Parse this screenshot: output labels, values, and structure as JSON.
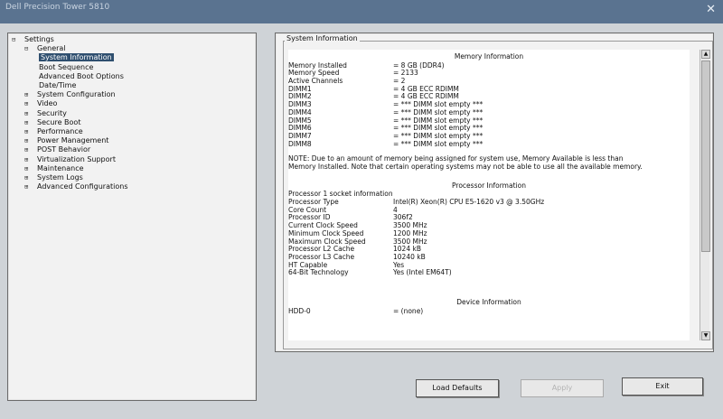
{
  "window": {
    "title": "Dell Precision Tower 5810",
    "close_icon": "close-icon"
  },
  "left_tree": {
    "root": "Settings",
    "items": [
      {
        "label": "General",
        "expanded": true,
        "children": [
          {
            "label": "System Information",
            "selected": true
          },
          {
            "label": "Boot Sequence"
          },
          {
            "label": "Advanced Boot Options"
          },
          {
            "label": "Date/Time"
          }
        ]
      },
      {
        "label": "System Configuration"
      },
      {
        "label": "Video"
      },
      {
        "label": "Security"
      },
      {
        "label": "Secure Boot"
      },
      {
        "label": "Performance"
      },
      {
        "label": "Power Management"
      },
      {
        "label": "POST Behavior"
      },
      {
        "label": "Virtualization Support"
      },
      {
        "label": "Maintenance"
      },
      {
        "label": "System Logs"
      },
      {
        "label": "Advanced Configurations"
      }
    ]
  },
  "right_panel": {
    "group_title": "System Information",
    "memory": {
      "header": "Memory Information",
      "rows": [
        {
          "key": "Memory Installed",
          "value": "= 8 GB (DDR4)"
        },
        {
          "key": "Memory Speed",
          "value": "= 2133"
        },
        {
          "key": "Active Channels",
          "value": "= 2"
        },
        {
          "key": "DIMM1",
          "value": "= 4 GB ECC RDIMM"
        },
        {
          "key": "DIMM2",
          "value": "= 4 GB ECC RDIMM"
        },
        {
          "key": "DIMM3",
          "value": "= *** DIMM slot empty ***"
        },
        {
          "key": "DIMM4",
          "value": "= *** DIMM slot empty ***"
        },
        {
          "key": "DIMM5",
          "value": "= *** DIMM slot empty ***"
        },
        {
          "key": "DIMM6",
          "value": "= *** DIMM slot empty ***"
        },
        {
          "key": "DIMM7",
          "value": "= *** DIMM slot empty ***"
        },
        {
          "key": "DIMM8",
          "value": "= *** DIMM slot empty ***"
        }
      ],
      "note": "NOTE: Due to an amount of memory being assigned for system use, Memory Available is less than Memory Installed. Note that certain operating systems may not be able to use all the available memory."
    },
    "processor": {
      "header": "Processor Information",
      "first_line": "Processor 1 socket information",
      "rows": [
        {
          "key": "Processor Type",
          "value": "Intel(R) Xeon(R) CPU E5-1620 v3 @ 3.50GHz"
        },
        {
          "key": "Core Count",
          "value": "4"
        },
        {
          "key": "Processor ID",
          "value": "306f2"
        },
        {
          "key": "Current Clock Speed",
          "value": "3500 MHz"
        },
        {
          "key": "Minimum Clock Speed",
          "value": "1200 MHz"
        },
        {
          "key": "Maximum Clock Speed",
          "value": "3500 MHz"
        },
        {
          "key": "Processor L2 Cache",
          "value": "1024 kB"
        },
        {
          "key": "Processor L3 Cache",
          "value": "10240 kB"
        },
        {
          "key": "HT Capable",
          "value": "Yes"
        },
        {
          "key": "64-Bit Technology",
          "value": "Yes (Intel EM64T)"
        }
      ]
    },
    "device": {
      "header": "Device Information",
      "rows": [
        {
          "key": "HDD-0",
          "value": "= (none)"
        }
      ]
    }
  },
  "buttons": {
    "load_defaults": "Load Defaults",
    "apply": "Apply",
    "exit": "Exit"
  }
}
